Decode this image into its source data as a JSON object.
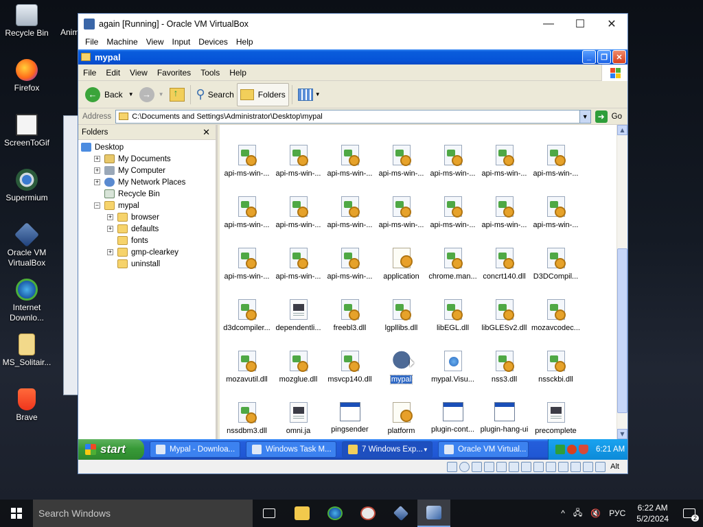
{
  "desktop": {
    "icons": [
      {
        "label": "Recycle Bin",
        "icon": "recycle-bin-icon"
      },
      {
        "label": "Firefox",
        "icon": "firefox-icon"
      },
      {
        "label": "ScreenToGif",
        "icon": "screentogif-icon"
      },
      {
        "label": "Supermium",
        "icon": "supermium-icon"
      },
      {
        "label": "Oracle VM VirtualBox",
        "icon": "virtualbox-icon"
      },
      {
        "label": "Internet Downlo...",
        "icon": "internet-download-icon"
      },
      {
        "label": "MS_Solitair...",
        "icon": "folder-icon"
      },
      {
        "label": "Brave",
        "icon": "brave-icon"
      }
    ],
    "partial_icon_label": "Anim"
  },
  "vbox": {
    "title": "again [Running] - Oracle VM VirtualBox",
    "menu": [
      "File",
      "Machine",
      "View",
      "Input",
      "Devices",
      "Help"
    ],
    "window_buttons": {
      "minimize": "—",
      "maximize": "☐",
      "close": "✕"
    },
    "status_host_key": "Alt"
  },
  "xp_window": {
    "title": "mypal",
    "menu": [
      "File",
      "Edit",
      "View",
      "Favorites",
      "Tools",
      "Help"
    ],
    "toolbar": {
      "back": "Back",
      "search": "Search",
      "folders": "Folders"
    },
    "address_label": "Address",
    "address_value": "C:\\Documents and Settings\\Administrator\\Desktop\\mypal",
    "go_label": "Go",
    "folders_header": "Folders",
    "tree": [
      {
        "label": "Desktop",
        "level": 0,
        "expander": "",
        "icon": "desk"
      },
      {
        "label": "My Documents",
        "level": 1,
        "expander": "+",
        "icon": "docs"
      },
      {
        "label": "My Computer",
        "level": 1,
        "expander": "+",
        "icon": "comp"
      },
      {
        "label": "My Network Places",
        "level": 1,
        "expander": "+",
        "icon": "net"
      },
      {
        "label": "Recycle Bin",
        "level": 1,
        "expander": "",
        "icon": "bin"
      },
      {
        "label": "mypal",
        "level": 1,
        "expander": "−",
        "icon": "folder"
      },
      {
        "label": "browser",
        "level": 2,
        "expander": "+",
        "icon": "folder"
      },
      {
        "label": "defaults",
        "level": 2,
        "expander": "+",
        "icon": "folder"
      },
      {
        "label": "fonts",
        "level": 2,
        "expander": "",
        "icon": "folder"
      },
      {
        "label": "gmp-clearkey",
        "level": 2,
        "expander": "+",
        "icon": "folder"
      },
      {
        "label": "uninstall",
        "level": 2,
        "expander": "",
        "icon": "folder"
      }
    ],
    "files": [
      {
        "name": "",
        "type": "dll"
      },
      {
        "name": "",
        "type": "dll"
      },
      {
        "name": "",
        "type": "dll"
      },
      {
        "name": "",
        "type": "dll"
      },
      {
        "name": "",
        "type": "dll"
      },
      {
        "name": "",
        "type": "dll"
      },
      {
        "name": "",
        "type": "dll"
      },
      {
        "name": "api-ms-win-...",
        "type": "dll"
      },
      {
        "name": "api-ms-win-...",
        "type": "dll"
      },
      {
        "name": "api-ms-win-...",
        "type": "dll"
      },
      {
        "name": "api-ms-win-...",
        "type": "dll"
      },
      {
        "name": "api-ms-win-...",
        "type": "dll"
      },
      {
        "name": "api-ms-win-...",
        "type": "dll"
      },
      {
        "name": "api-ms-win-...",
        "type": "dll"
      },
      {
        "name": "api-ms-win-...",
        "type": "dll"
      },
      {
        "name": "api-ms-win-...",
        "type": "dll"
      },
      {
        "name": "api-ms-win-...",
        "type": "dll"
      },
      {
        "name": "api-ms-win-...",
        "type": "dll"
      },
      {
        "name": "api-ms-win-...",
        "type": "dll"
      },
      {
        "name": "api-ms-win-...",
        "type": "dll"
      },
      {
        "name": "api-ms-win-...",
        "type": "dll"
      },
      {
        "name": "api-ms-win-...",
        "type": "dll"
      },
      {
        "name": "api-ms-win-...",
        "type": "dll"
      },
      {
        "name": "api-ms-win-...",
        "type": "dll"
      },
      {
        "name": "application",
        "type": "cfg"
      },
      {
        "name": "chrome.man...",
        "type": "dll"
      },
      {
        "name": "concrt140.dll",
        "type": "dll"
      },
      {
        "name": "D3DCompil...",
        "type": "dll"
      },
      {
        "name": "d3dcompiler...",
        "type": "dll"
      },
      {
        "name": "dependentli...",
        "type": "doc"
      },
      {
        "name": "freebl3.dll",
        "type": "dll"
      },
      {
        "name": "lgpllibs.dll",
        "type": "dll"
      },
      {
        "name": "libEGL.dll",
        "type": "dll"
      },
      {
        "name": "libGLESv2.dll",
        "type": "dll"
      },
      {
        "name": "mozavcodec...",
        "type": "dll"
      },
      {
        "name": "mozavutil.dll",
        "type": "dll"
      },
      {
        "name": "mozglue.dll",
        "type": "dll"
      },
      {
        "name": "msvcp140.dll",
        "type": "dll"
      },
      {
        "name": "mypal",
        "type": "app",
        "selected": true
      },
      {
        "name": "mypal.Visu...",
        "type": "web"
      },
      {
        "name": "nss3.dll",
        "type": "dll"
      },
      {
        "name": "nssckbi.dll",
        "type": "dll"
      },
      {
        "name": "nssdbm3.dll",
        "type": "dll"
      },
      {
        "name": "omni.ja",
        "type": "doc"
      },
      {
        "name": "pingsender",
        "type": "exe"
      },
      {
        "name": "platform",
        "type": "cfg"
      },
      {
        "name": "plugin-cont...",
        "type": "exe"
      },
      {
        "name": "plugin-hang-ui",
        "type": "exe"
      },
      {
        "name": "precomplete",
        "type": "doc"
      },
      {
        "name": "",
        "type": "dll"
      },
      {
        "name": "",
        "type": "doc"
      },
      {
        "name": "",
        "type": "dll"
      },
      {
        "name": "",
        "type": "dll"
      },
      {
        "name": "",
        "type": "dll"
      },
      {
        "name": "",
        "type": "dll"
      }
    ]
  },
  "xp_taskbar": {
    "start_label": "start",
    "tasks": [
      {
        "label": "Mypal - Downloa...",
        "active": false
      },
      {
        "label": "Windows Task M...",
        "active": false
      },
      {
        "label": "7 Windows Exp...",
        "active": true
      },
      {
        "label": "Oracle VM Virtual...",
        "active": false
      }
    ],
    "clock": "6:21 AM"
  },
  "win10_taskbar": {
    "search_placeholder": "Search Windows",
    "language": "РУС",
    "time": "6:22 AM",
    "date": "5/2/2024",
    "notification_count": "2",
    "tray_up": "^"
  },
  "colors": {
    "xp_title_blue": "#0654d8",
    "xp_selection": "#316ac5",
    "xp_start_green": "#389a38"
  }
}
